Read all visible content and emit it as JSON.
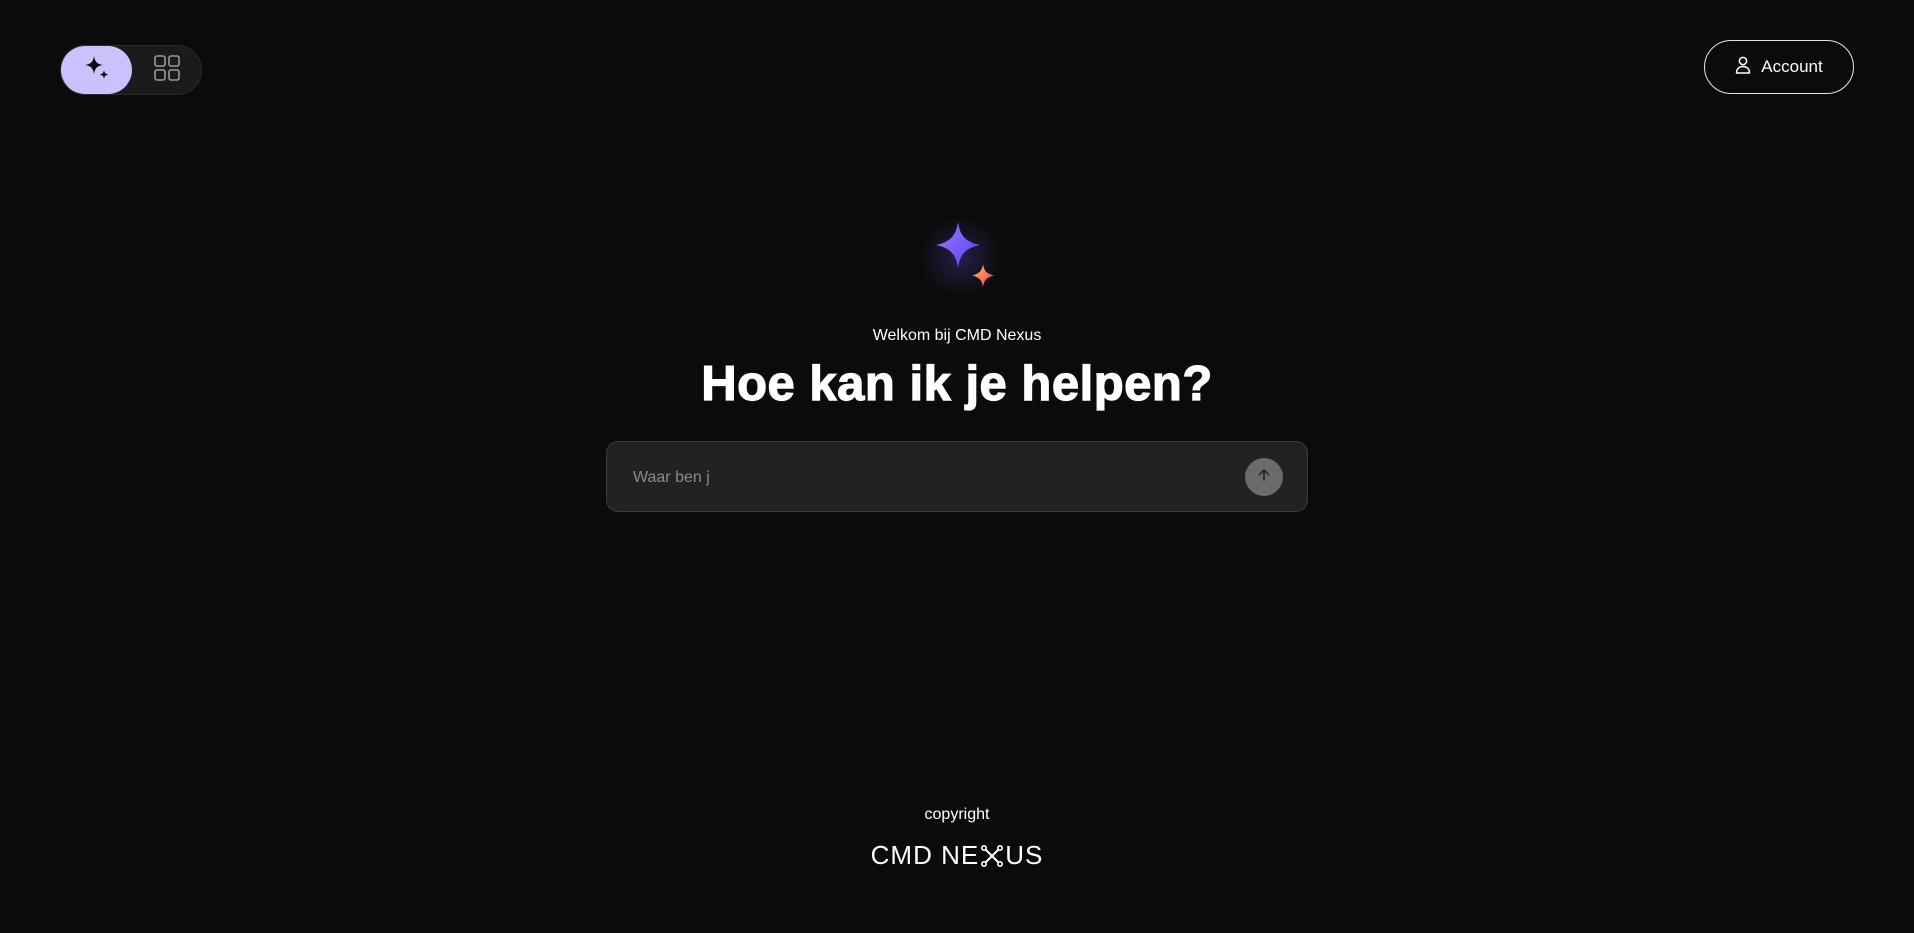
{
  "header": {
    "view_toggle": {
      "active": "chat",
      "options": [
        {
          "id": "chat",
          "icon": "sparkle-icon"
        },
        {
          "id": "apps",
          "icon": "grid-icon"
        }
      ]
    },
    "account_label": "Account",
    "account_icon": "user-icon"
  },
  "hero": {
    "logo_icon": "sparkles-logo-icon",
    "welcome": "Welkom bij CMD Nexus",
    "headline": "Hoe kan ik je helpen?"
  },
  "prompt": {
    "placeholder": "Waar ben j",
    "value": "",
    "send_icon": "arrow-up-icon"
  },
  "footer": {
    "copyright": "copyright",
    "brand_left": "CMD NE",
    "brand_right": "US",
    "brand_x_icon": "x-connector-icon"
  },
  "colors": {
    "background": "#0b0b0b",
    "toggle_active": "#cbc1ff",
    "input_bg": "#222222",
    "send_button": "#6b6b6b",
    "logo_purple": "#7a5cff",
    "logo_pink": "#ff3d8b",
    "logo_yellow": "#ffd23f"
  }
}
